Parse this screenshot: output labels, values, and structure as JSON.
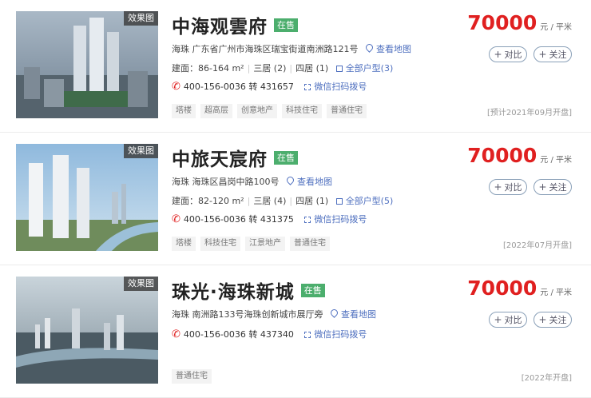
{
  "listings": [
    {
      "badge": "效果图",
      "title": "中海观雲府",
      "status": "在售",
      "address": "海珠 广东省广州市海珠区瑞宝街道南洲路121号",
      "map_link": "查看地图",
      "area": "建面：86-164 m²",
      "layouts": [
        "三居 (2)",
        "四居 (1)"
      ],
      "plan_link": "全部户型(3)",
      "phone": "400-156-0036 转 431657",
      "wechat": "微信扫码拨号",
      "tags": [
        "塔楼",
        "超高层",
        "创意地产",
        "科技住宅",
        "普通住宅"
      ],
      "price": "70000",
      "price_unit": "元 / 平米",
      "compare": "对比",
      "follow": "关注",
      "open_date": "[预计2021年09月开盘]"
    },
    {
      "badge": "效果图",
      "title": "中旅天宸府",
      "status": "在售",
      "address": "海珠 海珠区昌岗中路100号",
      "map_link": "查看地图",
      "area": "建面：82-120 m²",
      "layouts": [
        "三居 (4)",
        "四居 (1)"
      ],
      "plan_link": "全部户型(5)",
      "phone": "400-156-0036 转 431375",
      "wechat": "微信扫码拨号",
      "tags": [
        "塔楼",
        "科技住宅",
        "江景地产",
        "普通住宅"
      ],
      "price": "70000",
      "price_unit": "元 / 平米",
      "compare": "对比",
      "follow": "关注",
      "open_date": "[2022年07月开盘]"
    },
    {
      "badge": "效果图",
      "title": "珠光·海珠新城",
      "status": "在售",
      "address": "海珠 南洲路133号海珠创新城市展厅旁",
      "map_link": "查看地图",
      "phone": "400-156-0036 转 437340",
      "wechat": "微信扫码拨号",
      "tags": [
        "普通住宅"
      ],
      "price": "70000",
      "price_unit": "元 / 平米",
      "compare": "对比",
      "follow": "关注",
      "open_date": "[2022年开盘]"
    }
  ]
}
